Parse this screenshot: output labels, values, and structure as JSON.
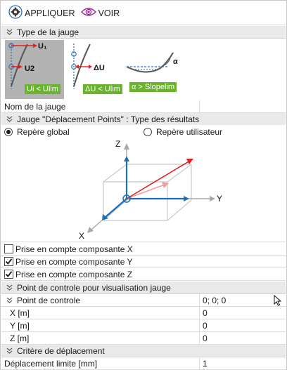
{
  "toolbar": {
    "apply_label": "APPLIQUER",
    "view_label": "VOIR"
  },
  "sections": {
    "gauge_type": "Type de la jauge",
    "results_type": "Jauge \"Déplacement Points\" : Type des résultats",
    "control_point": "Point de controle pour visualisation jauge",
    "displacement_criterion": "Critère de déplacement"
  },
  "gauge_types": [
    {
      "tag": "Ui < Ulim",
      "labels": [
        "U₁",
        "U2"
      ],
      "selected": true
    },
    {
      "tag": "ΔU < Ulim",
      "labels": [
        "ΔU"
      ],
      "selected": false
    },
    {
      "tag": "α > Slopelim",
      "labels": [
        "α"
      ],
      "selected": false
    }
  ],
  "gauge_name": {
    "label": "Nom de la jauge",
    "value": ""
  },
  "reference": {
    "options": [
      "Repère global",
      "Repère utilisateur"
    ],
    "selected": "Repère global"
  },
  "axes_labels": {
    "z": "Z",
    "y": "Y",
    "x": "X"
  },
  "components": [
    {
      "label": "Prise en compte composante X",
      "checked": false
    },
    {
      "label": "Prise en compte composante Y",
      "checked": true
    },
    {
      "label": "Prise en compte composante Z",
      "checked": true
    }
  ],
  "control_point": {
    "label": "Point de controle",
    "value": "0; 0; 0",
    "rows": [
      {
        "label": "X  [m]",
        "value": "0"
      },
      {
        "label": "Y  [m]",
        "value": "0"
      },
      {
        "label": "Z  [m]",
        "value": "0"
      }
    ]
  },
  "criterion": {
    "label": "Déplacement limite  [mm]",
    "value": "1"
  },
  "colors": {
    "accent_green": "#6ab42d",
    "arrow_red": "#e02020",
    "axis_blue": "#1f6fb5",
    "section_bg": "#e9e9e9"
  }
}
